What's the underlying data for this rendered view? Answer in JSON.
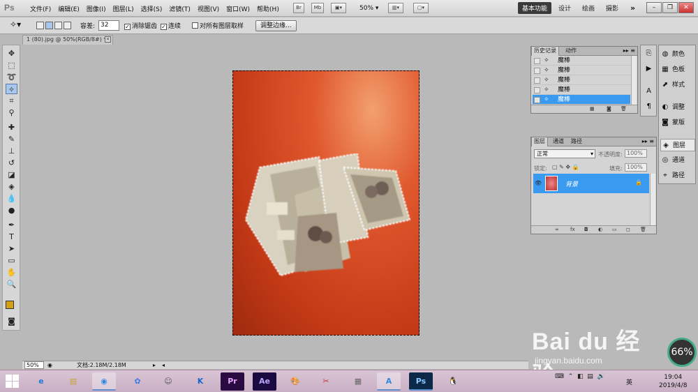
{
  "app": {
    "logo": "Ps"
  },
  "menu": {
    "items": [
      "文件(F)",
      "编辑(E)",
      "图像(I)",
      "图层(L)",
      "选择(S)",
      "滤镜(T)",
      "视图(V)",
      "窗口(W)",
      "帮助(H)"
    ],
    "bridge_label": "Br",
    "minibridge_label": "Mb",
    "zoom": "50%",
    "workspaces": [
      "基本功能",
      "设计",
      "绘画",
      "摄影"
    ],
    "active_workspace": "基本功能",
    "more": "»"
  },
  "options": {
    "tolerance_label": "容差:",
    "tolerance_value": "32",
    "antialias_label": "消除锯齿",
    "antialias_checked": true,
    "contiguous_label": "连续",
    "contiguous_checked": true,
    "sample_all_label": "对所有图层取样",
    "sample_all_checked": false,
    "refine_edge_label": "调整边缘..."
  },
  "document": {
    "tab_title": "1 (80).jpg @ 50%(RGB/8#) *",
    "status_zoom": "50%",
    "doc_size": "文档:2.18M/2.18M"
  },
  "history": {
    "tabs": [
      "历史记录",
      "动作"
    ],
    "rows": [
      {
        "label": "魔棒",
        "active": false
      },
      {
        "label": "魔棒",
        "active": false
      },
      {
        "label": "魔棒",
        "active": false
      },
      {
        "label": "魔棒",
        "active": false
      },
      {
        "label": "魔棒",
        "active": true
      }
    ]
  },
  "layers": {
    "tabs": [
      "图层",
      "通道",
      "路径"
    ],
    "blend_mode": "正常",
    "opacity_label": "不透明度:",
    "opacity_value": "100%",
    "lock_label": "锁定:",
    "fill_label": "填充:",
    "fill_value": "100%",
    "layer_name": "背景"
  },
  "dock": {
    "items": [
      {
        "label": "颜色",
        "icon": "color-icon"
      },
      {
        "label": "色板",
        "icon": "swatches-icon"
      },
      {
        "label": "样式",
        "icon": "styles-icon"
      },
      {
        "label": "调整",
        "icon": "adjustments-icon"
      },
      {
        "label": "蒙版",
        "icon": "masks-icon"
      },
      {
        "label": "图层",
        "icon": "layers-icon"
      },
      {
        "label": "通道",
        "icon": "channels-icon"
      },
      {
        "label": "路径",
        "icon": "paths-icon"
      }
    ],
    "active": "图层"
  },
  "watermark": {
    "logo": "Bai du 经验",
    "url": "jingyan.baidu.com"
  },
  "gauge": {
    "value": "66%"
  },
  "taskbar": {
    "ime": "英",
    "time": "19:04",
    "date": "2019/4/8",
    "apps": [
      "e",
      "▤",
      "◉",
      "✿",
      "☺",
      "K",
      "Pr",
      "Ae",
      "🎨",
      "✂",
      "▦",
      "A",
      "Ps",
      "🐧"
    ]
  },
  "colors": {
    "foreground": "#d4a017",
    "background": "#ffffff",
    "selection": "#3a9af0"
  }
}
